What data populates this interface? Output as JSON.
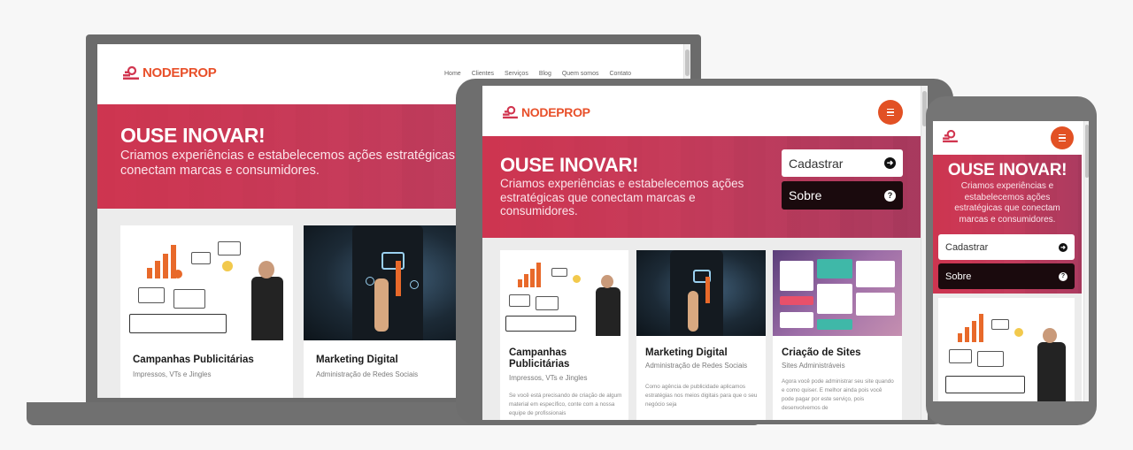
{
  "brand": {
    "name": "NODEPROP",
    "color": "#e8502a"
  },
  "nav": [
    "Home",
    "Clientes",
    "Serviços",
    "Blog",
    "Quem somos",
    "Contato"
  ],
  "hero": {
    "title": "OUSE INOVAR!",
    "text": "Criamos experiências e estabelecemos ações estratégicas que conectam marcas e consumidores.",
    "laptop_line1": "Criamos experiências e estabelecemos ações estratégicas que",
    "laptop_line2": "conectam marcas e consumidores.",
    "color": "#d1354f"
  },
  "buttons": {
    "cadastrar": "Cadastrar",
    "sobre": "Sobre",
    "cadastrar_icon": "arrow-right-icon",
    "sobre_icon": "question-icon"
  },
  "cards": [
    {
      "title": "Campanhas Publicitárias",
      "subtitle": "Impressos, VTs e Jingles",
      "text": "Se você está precisando de criação de algum material em específico, conte com a nossa equipe de profissionais",
      "image": "strategy-sketch"
    },
    {
      "title": "Marketing Digital",
      "subtitle": "Administração de Redes Sociais",
      "text": "Como agência de publicidade aplicamos estratégias nos meios digitais para que o seu negócio seja",
      "image": "digital-touch"
    },
    {
      "title": "Criação de Sites",
      "subtitle": "Sites Administráveis",
      "text": "Agora você pode administrar seu site quando e como quiser. E melhor ainda pois você pode pagar por este serviço, pois desenvolvemos de",
      "image": "site-ui"
    }
  ],
  "devices": [
    "laptop",
    "tablet",
    "phone"
  ]
}
